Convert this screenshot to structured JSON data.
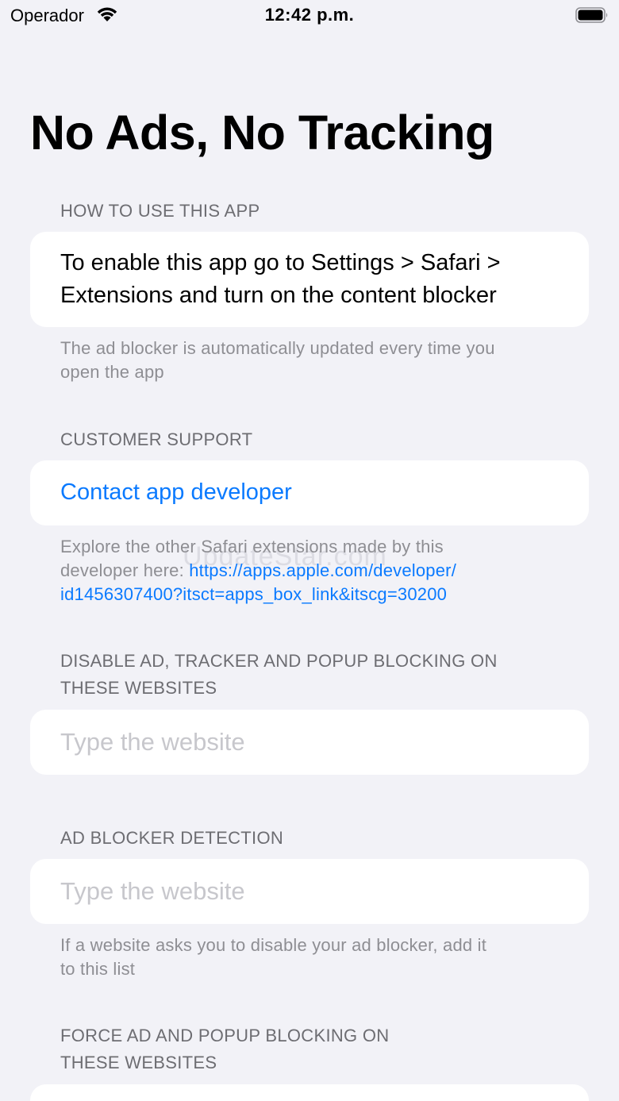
{
  "status_bar": {
    "carrier": "Operador",
    "time": "12:42 p.m."
  },
  "title": "No Ads, No Tracking",
  "how_to": {
    "header": "HOW TO USE THIS APP",
    "body_line1": "To enable this app go to Settings > Safari >",
    "body_line2": "Extensions and turn on the content blocker",
    "footer_line1": "The ad blocker is automatically updated every time you",
    "footer_line2": "open the app"
  },
  "support": {
    "header": "CUSTOMER SUPPORT",
    "contact_label": "Contact app developer",
    "footer_line1": "Explore the other Safari extensions made by this",
    "footer_prefix": "developer here: ",
    "link_line1": "https://apps.apple.com/developer/",
    "link_line2": "id1456307400?itsct=apps_box_link&itscg=30200"
  },
  "disable_blocking": {
    "header_line1": "DISABLE AD, TRACKER AND POPUP BLOCKING ON",
    "header_line2": "THESE WEBSITES",
    "placeholder": "Type the website"
  },
  "detection": {
    "header": "AD BLOCKER DETECTION",
    "placeholder": "Type the website",
    "footer_line1": "If a website asks you to disable your ad blocker, add it",
    "footer_line2": "to this list"
  },
  "force_blocking": {
    "header_line1": "FORCE AD AND POPUP BLOCKING ON",
    "header_line2": "THESE WEBSITES"
  },
  "watermark": "UpdateStar.com",
  "colors": {
    "background": "#f2f2f7",
    "card": "#ffffff",
    "accent": "#0a7aff",
    "secondary_text": "#6d6d72",
    "placeholder": "#c7c7cc"
  }
}
